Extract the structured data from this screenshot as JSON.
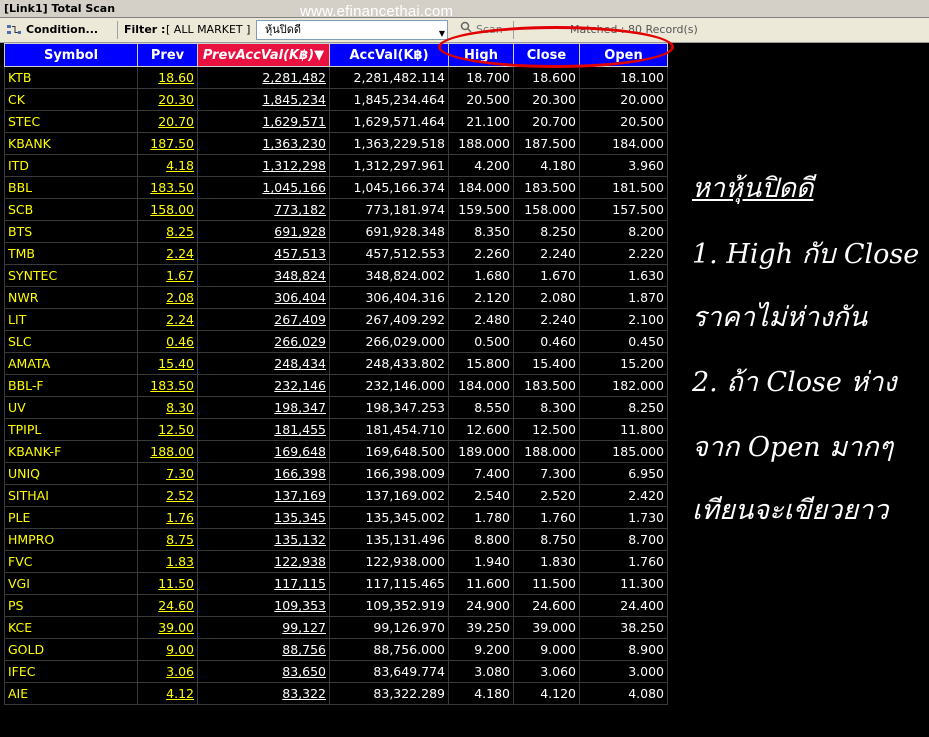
{
  "window": {
    "title": "[Link1] Total Scan"
  },
  "toolbar": {
    "condition_label": "Condition...",
    "filter_label": "Filter :",
    "filter_value": "[ ALL MARKET ]",
    "combo_value": "หุ้นปิดดี",
    "scan_label": "Scan",
    "matched_text": "Matched : 80 Record(s)"
  },
  "watermark": "www.efinancethai.com",
  "columns": [
    "Symbol",
    "Prev",
    "PrevAccVal(K฿)▼",
    "AccVal(K฿)",
    "High",
    "Close",
    "Open"
  ],
  "rows": [
    [
      "KTB",
      "18.60",
      "2,281,482",
      "2,281,482.114",
      "18.700",
      "18.600",
      "18.100"
    ],
    [
      "CK",
      "20.30",
      "1,845,234",
      "1,845,234.464",
      "20.500",
      "20.300",
      "20.000"
    ],
    [
      "STEC",
      "20.70",
      "1,629,571",
      "1,629,571.464",
      "21.100",
      "20.700",
      "20.500"
    ],
    [
      "KBANK",
      "187.50",
      "1,363,230",
      "1,363,229.518",
      "188.000",
      "187.500",
      "184.000"
    ],
    [
      "ITD",
      "4.18",
      "1,312,298",
      "1,312,297.961",
      "4.200",
      "4.180",
      "3.960"
    ],
    [
      "BBL",
      "183.50",
      "1,045,166",
      "1,045,166.374",
      "184.000",
      "183.500",
      "181.500"
    ],
    [
      "SCB",
      "158.00",
      "773,182",
      "773,181.974",
      "159.500",
      "158.000",
      "157.500"
    ],
    [
      "BTS",
      "8.25",
      "691,928",
      "691,928.348",
      "8.350",
      "8.250",
      "8.200"
    ],
    [
      "TMB",
      "2.24",
      "457,513",
      "457,512.553",
      "2.260",
      "2.240",
      "2.220"
    ],
    [
      "SYNTEC",
      "1.67",
      "348,824",
      "348,824.002",
      "1.680",
      "1.670",
      "1.630"
    ],
    [
      "NWR",
      "2.08",
      "306,404",
      "306,404.316",
      "2.120",
      "2.080",
      "1.870"
    ],
    [
      "LIT",
      "2.24",
      "267,409",
      "267,409.292",
      "2.480",
      "2.240",
      "2.100"
    ],
    [
      "SLC",
      "0.46",
      "266,029",
      "266,029.000",
      "0.500",
      "0.460",
      "0.450"
    ],
    [
      "AMATA",
      "15.40",
      "248,434",
      "248,433.802",
      "15.800",
      "15.400",
      "15.200"
    ],
    [
      "BBL-F",
      "183.50",
      "232,146",
      "232,146.000",
      "184.000",
      "183.500",
      "182.000"
    ],
    [
      "UV",
      "8.30",
      "198,347",
      "198,347.253",
      "8.550",
      "8.300",
      "8.250"
    ],
    [
      "TPIPL",
      "12.50",
      "181,455",
      "181,454.710",
      "12.600",
      "12.500",
      "11.800"
    ],
    [
      "KBANK-F",
      "188.00",
      "169,648",
      "169,648.500",
      "189.000",
      "188.000",
      "185.000"
    ],
    [
      "UNIQ",
      "7.30",
      "166,398",
      "166,398.009",
      "7.400",
      "7.300",
      "6.950"
    ],
    [
      "SITHAI",
      "2.52",
      "137,169",
      "137,169.002",
      "2.540",
      "2.520",
      "2.420"
    ],
    [
      "PLE",
      "1.76",
      "135,345",
      "135,345.002",
      "1.780",
      "1.760",
      "1.730"
    ],
    [
      "HMPRO",
      "8.75",
      "135,132",
      "135,131.496",
      "8.800",
      "8.750",
      "8.700"
    ],
    [
      "FVC",
      "1.83",
      "122,938",
      "122,938.000",
      "1.940",
      "1.830",
      "1.760"
    ],
    [
      "VGI",
      "11.50",
      "117,115",
      "117,115.465",
      "11.600",
      "11.500",
      "11.300"
    ],
    [
      "PS",
      "24.60",
      "109,353",
      "109,352.919",
      "24.900",
      "24.600",
      "24.400"
    ],
    [
      "KCE",
      "39.00",
      "99,127",
      "99,126.970",
      "39.250",
      "39.000",
      "38.250"
    ],
    [
      "GOLD",
      "9.00",
      "88,756",
      "88,756.000",
      "9.200",
      "9.000",
      "8.900"
    ],
    [
      "IFEC",
      "3.06",
      "83,650",
      "83,649.774",
      "3.080",
      "3.060",
      "3.000"
    ],
    [
      "AIE",
      "4.12",
      "83,322",
      "83,322.289",
      "4.180",
      "4.120",
      "4.080"
    ]
  ],
  "annotation": {
    "title": "หาหุ้นปิดดี",
    "line1": "1. High กับ Close",
    "line2": "ราคาไม่ห่างกัน",
    "line3": "2. ถ้า Close ห่าง",
    "line4": "จาก Open มากๆ",
    "line5": "เทียนจะเขียวยาว"
  },
  "colors": {
    "header_bg": "#0000ff",
    "sorted_header_bg": "#e8113f",
    "symbol_text": "#ffff00",
    "highlight_oval": "#e00000"
  }
}
